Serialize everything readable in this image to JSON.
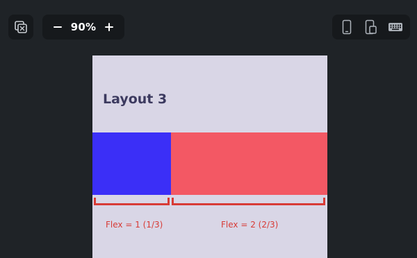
{
  "toolbar": {
    "left_icon": "selection-mode-icon",
    "zoom": {
      "decrease_icon": "minus-icon",
      "level": "90%",
      "increase_icon": "plus-icon"
    },
    "device_icons": [
      "phone-icon",
      "tablet-icon",
      "keyboard-icon"
    ]
  },
  "preview": {
    "title": "Layout 3",
    "flex_items": [
      {
        "flex": 1,
        "label": "Flex = 1 (1/3)",
        "color": "#3b2ff7"
      },
      {
        "flex": 2,
        "label": "Flex = 2 (2/3)",
        "color": "#f35864"
      }
    ],
    "background_color": "#d9d6e6",
    "annotation_color": "#d83b36"
  }
}
